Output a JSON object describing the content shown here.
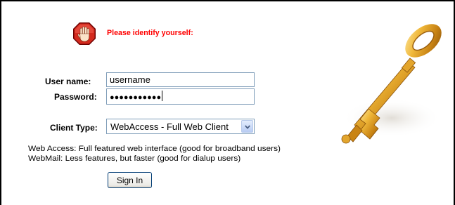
{
  "header": {
    "prompt": "Please identify yourself:",
    "prompt_color": "#ff0000",
    "stop_icon": "stop-hand-icon"
  },
  "form": {
    "username_label": "User name:",
    "username_value": "username",
    "password_label": "Password:",
    "password_mask": "●●●●●●●●●●●",
    "client_type_label": "Client Type:",
    "client_type_selected": "WebAccess - Full Web Client",
    "dropdown_icon": "chevron-down-icon"
  },
  "info": {
    "line1": "Web Access: Full featured web interface (good for broadband users)",
    "line2": "WebMail: Less features, but faster (good for dialup users)"
  },
  "actions": {
    "signin_label": "Sign In"
  },
  "decor": {
    "key_image": "golden-key-icon",
    "key_color": "#d79a1e"
  }
}
